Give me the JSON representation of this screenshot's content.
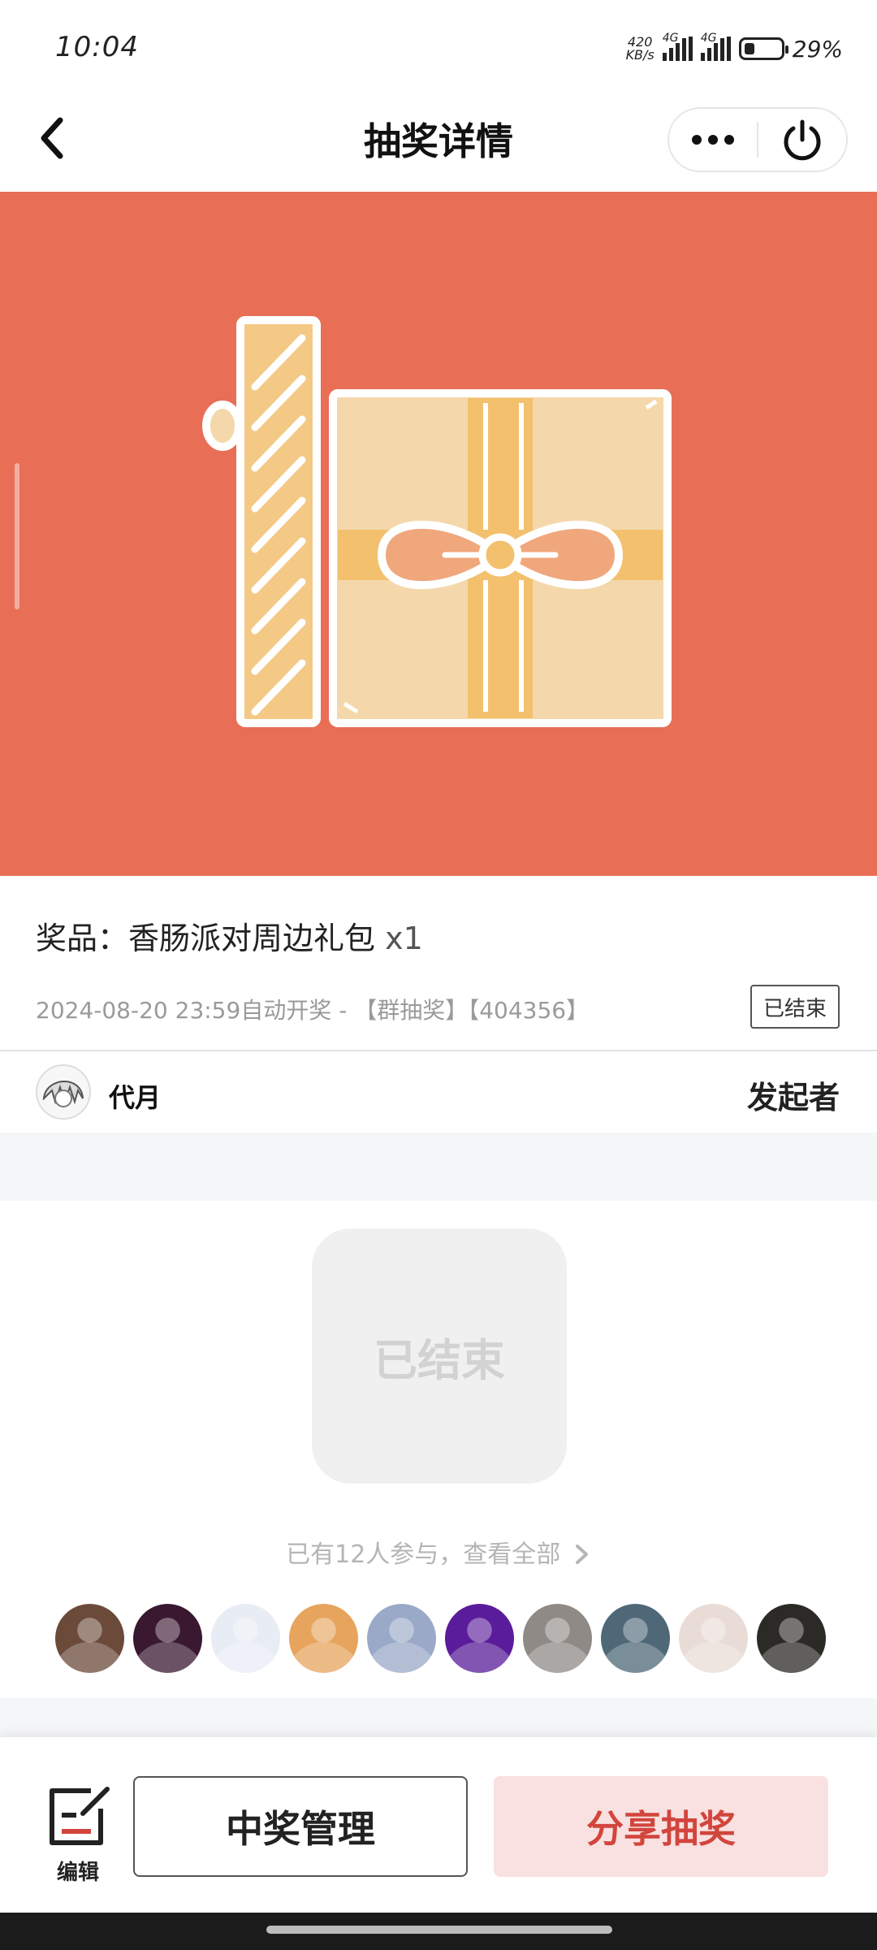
{
  "status_bar": {
    "time": "10:04",
    "net_speed_top": "420",
    "net_speed_bottom": "KB/s",
    "signal1_label": "4G",
    "signal2_label": "4G",
    "battery_percent": "29%",
    "battery_level": 0.29
  },
  "nav": {
    "title": "抽奖详情",
    "back_icon": "chevron-left-icon",
    "more_icon": "more-dots-icon",
    "close_icon": "power-icon"
  },
  "banner": {
    "background": "#e86e56",
    "illustration": "gift-box-icon"
  },
  "prize": {
    "label": "奖品：香肠派对周边礼包",
    "quantity": "x1"
  },
  "meta": {
    "text": "2024-08-20 23:59自动开奖 - 【群抽奖】【404356】",
    "status_badge": "已结束"
  },
  "creator": {
    "name": "代月",
    "role": "发起者"
  },
  "result_box": {
    "text": "已结束"
  },
  "participants": {
    "link_text": "已有12人参与，查看全部",
    "link_icon": "chevron-right-icon",
    "avatar_colors": [
      "#6b4a3a",
      "#3a1830",
      "#e8ecf4",
      "#e7a45d",
      "#9aa9c7",
      "#5a1c9a",
      "#8f8a86",
      "#4e6878",
      "#e9dcd6",
      "#2c2a26"
    ]
  },
  "bottom_bar": {
    "edit_label": "编辑",
    "edit_icon": "edit-icon",
    "manage_label": "中奖管理",
    "share_label": "分享抽奖",
    "share_bg": "#f8e1e0",
    "share_color": "#d2453d"
  }
}
